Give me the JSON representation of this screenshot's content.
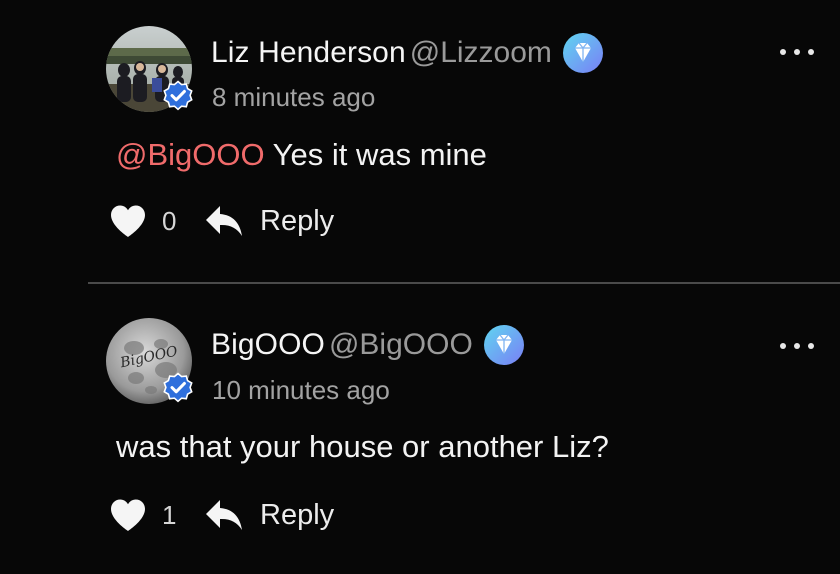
{
  "comments": [
    {
      "display_name": "Liz Henderson",
      "handle": "@Lizzoom",
      "timestamp": "8 minutes ago",
      "mention": "@BigOOO",
      "text": " Yes it was mine",
      "like_count": "0",
      "reply_label": "Reply",
      "avatar_icon": "group-photo-avatar",
      "badge_icon": "diamond-badge-icon",
      "verified_icon": "verified-check-icon"
    },
    {
      "display_name": "BigOOO",
      "handle": "@BigOOO",
      "timestamp": "10 minutes ago",
      "mention": "",
      "text": "was that your house or another Liz?",
      "like_count": "1",
      "reply_label": "Reply",
      "avatar_icon": "moon-avatar",
      "avatar_lettering": "BigOOO",
      "badge_icon": "diamond-badge-icon",
      "verified_icon": "verified-check-icon"
    }
  ],
  "colors": {
    "background": "#070707",
    "mention": "#f06b6b",
    "verified": "#2f6fdc",
    "gem_gradient_start": "#5fd6f0",
    "gem_gradient_end": "#7a7ef5",
    "divider": "#4a4a4a"
  }
}
